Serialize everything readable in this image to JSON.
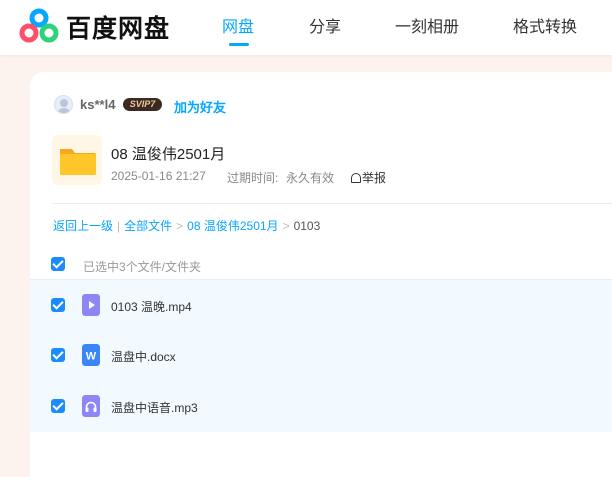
{
  "brand": {
    "name": "百度网盘"
  },
  "nav": {
    "items": [
      {
        "label": "网盘"
      },
      {
        "label": "分享"
      },
      {
        "label": "一刻相册"
      },
      {
        "label": "格式转换"
      }
    ]
  },
  "share": {
    "username": "ks**l4",
    "badge": "SVIP7",
    "add_friend": "加为好友",
    "folder_name": "08 温俊伟2501月",
    "date": "2025-01-16 21:27",
    "expiry_label": "过期时间:",
    "expiry_value": "永久有效",
    "report": "举报"
  },
  "breadcrumb": {
    "back": "返回上一级",
    "all_files": "全部文件",
    "folder": "08 温俊伟2501月",
    "current": "0103"
  },
  "selection": {
    "text": "已选中3个文件/文件夹"
  },
  "files": [
    {
      "name": "0103 温晚.mp4",
      "type": "video",
      "icon_color": "#8f86f5"
    },
    {
      "name": "温盘中.docx",
      "type": "word",
      "icon_color": "#3a86f7",
      "glyph": "W"
    },
    {
      "name": "温盘中语音.mp3",
      "type": "audio",
      "icon_color": "#8f86f5"
    }
  ],
  "colors": {
    "accent": "#06a7ff",
    "checkbox": "#1a8cff",
    "page_bg": "#fdf3ee",
    "folder": "#ffc629"
  }
}
